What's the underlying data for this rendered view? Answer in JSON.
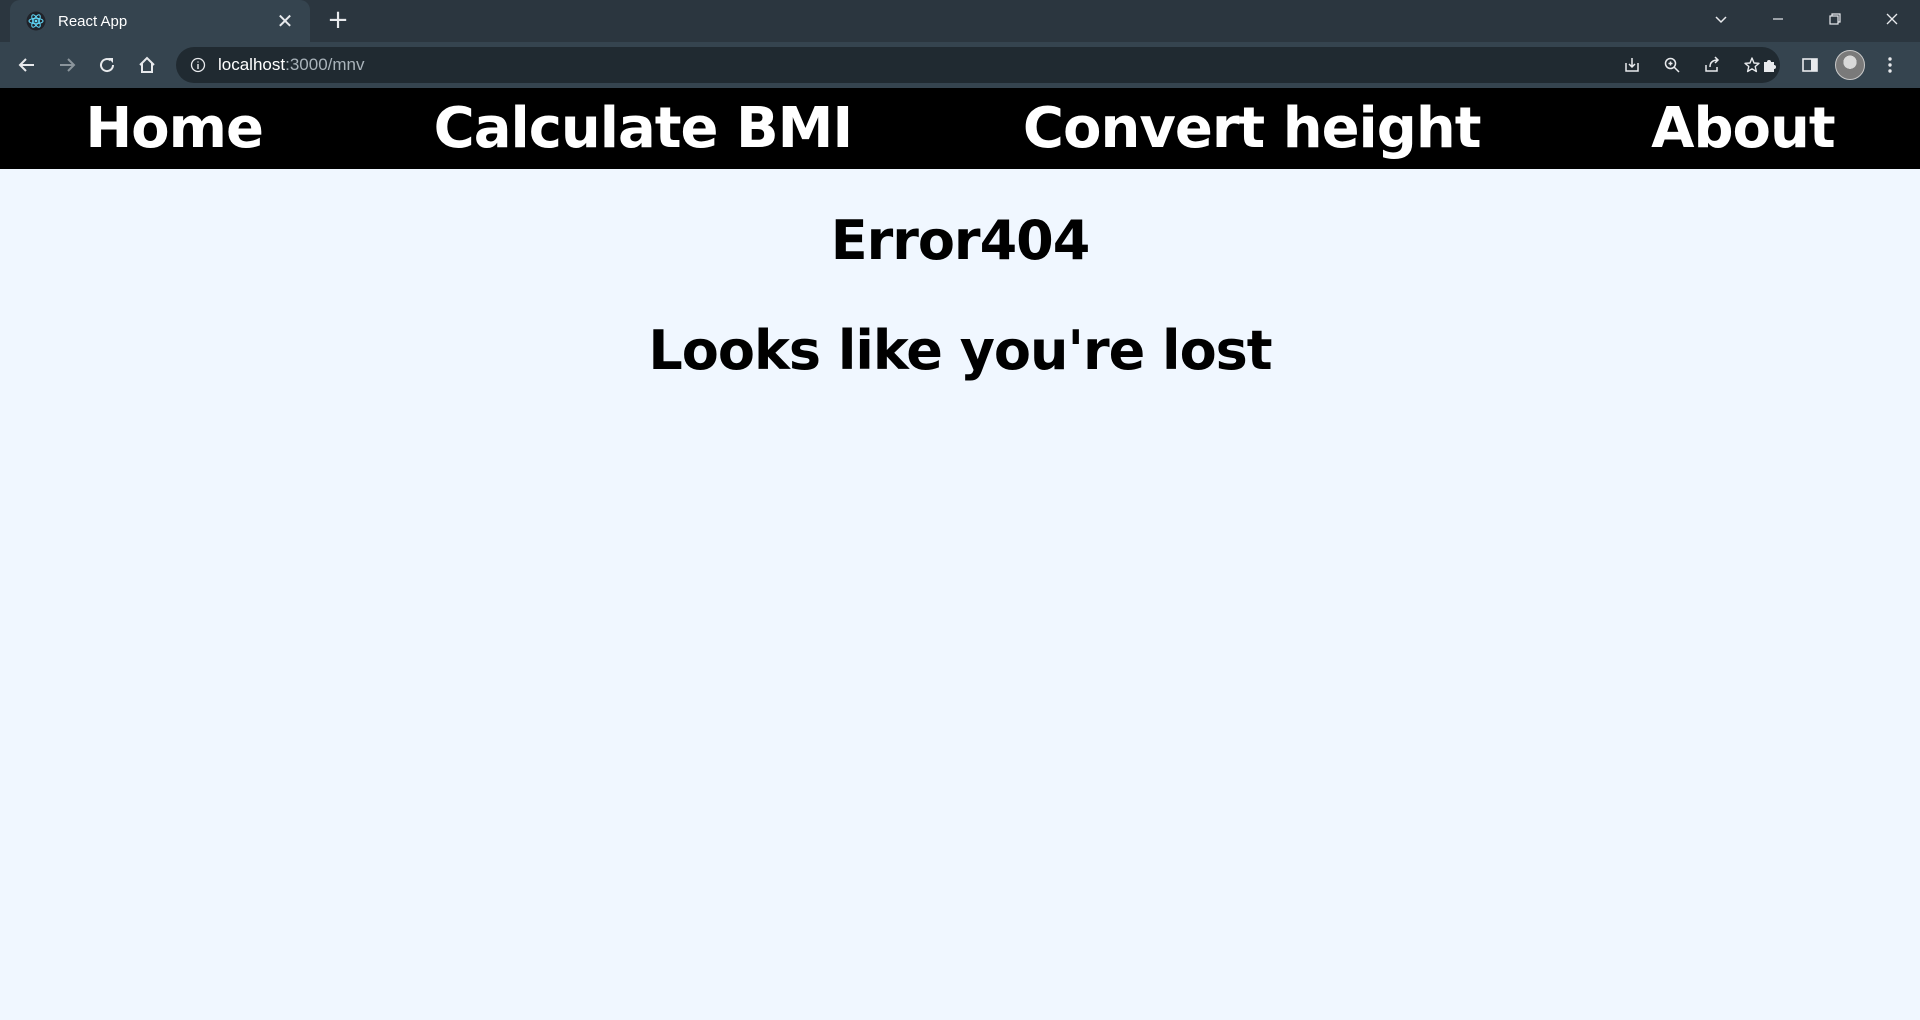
{
  "browser": {
    "tab_title": "React App",
    "url_host": "localhost",
    "url_path": ":3000/mnv"
  },
  "nav": {
    "items": [
      {
        "label": "Home"
      },
      {
        "label": "Calculate BMI"
      },
      {
        "label": "Convert height"
      },
      {
        "label": "About"
      }
    ]
  },
  "main": {
    "title": "Error404",
    "subtitle": "Looks like you're lost"
  },
  "colors": {
    "navbar_bg": "#000000",
    "page_bg": "#f0f7ff",
    "chrome_bg": "#35444f"
  }
}
